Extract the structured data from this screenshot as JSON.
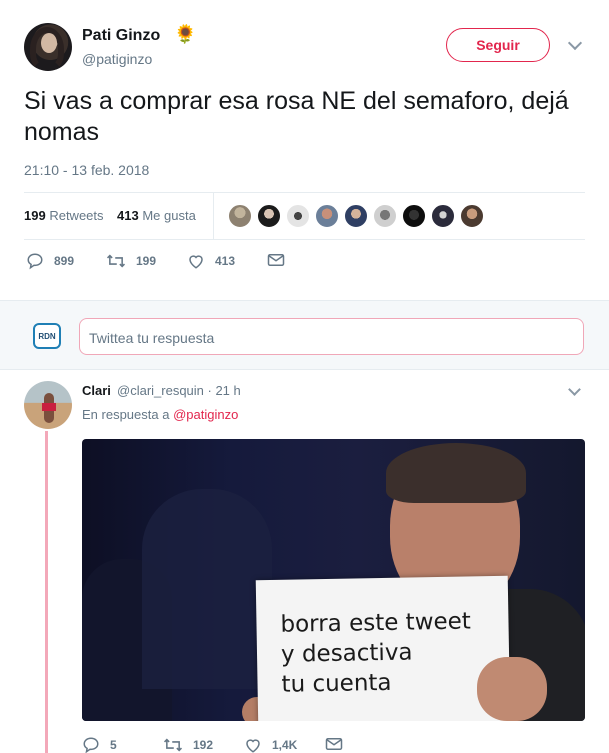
{
  "tweet": {
    "author_name": "Pati Ginzo",
    "author_emoji": "🌻",
    "author_handle": "@patiginzo",
    "follow_label": "Seguir",
    "text": "Si vas a comprar esa rosa NE del semaforo, dejá nomas",
    "timestamp": "21:10 - 13 feb. 2018",
    "retweets_count": "199",
    "retweets_label": "Retweets",
    "likes_count": "413",
    "likes_label": "Me gusta",
    "actions": {
      "replies": "899",
      "retweets": "199",
      "likes": "413"
    }
  },
  "reply_box": {
    "logo_text": "RDN",
    "placeholder": "Twittea tu respuesta"
  },
  "reply": {
    "author_name": "Clari",
    "meta": "@clari_resquin · 21 h",
    "reply_to_prefix": "En respuesta a",
    "reply_to_handle": "@patiginzo",
    "image_text_lines": [
      "borra este tweet",
      "y desactiva",
      "tu cuenta"
    ],
    "actions": {
      "replies": "5",
      "retweets": "192",
      "likes": "1,4K"
    }
  },
  "colors": {
    "accent": "#e2264d",
    "muted": "#657786",
    "thread": "#f3a8b9"
  },
  "icons": [
    "sunflower-emoji",
    "chevron-down-icon",
    "reply-icon",
    "retweet-icon",
    "like-icon",
    "message-icon"
  ]
}
